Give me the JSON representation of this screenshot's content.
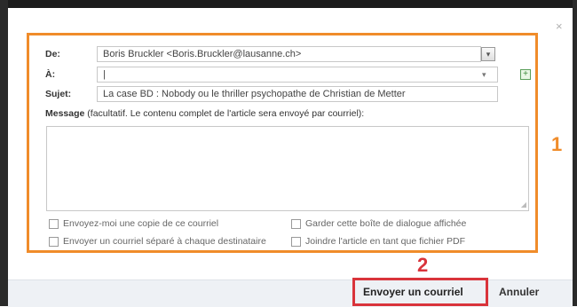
{
  "dialog": {
    "close_symbol": "×",
    "from": {
      "label": "De:",
      "value": "Boris Bruckler <Boris.Bruckler@lausanne.ch>"
    },
    "to": {
      "label": "À:",
      "value": "|"
    },
    "subject": {
      "label": "Sujet:",
      "value": "La case BD : Nobody ou le thriller psychopathe de Christian de Metter"
    },
    "message": {
      "label_bold": "Message",
      "label_note": " (facultatif. Le contenu complet de l'article sera envoyé par courriel):",
      "value": ""
    },
    "options": [
      {
        "label": "Envoyez-moi une copie de ce courriel",
        "checked": false
      },
      {
        "label": "Garder cette boîte de dialogue affichée",
        "checked": false
      },
      {
        "label": "Envoyer un courriel séparé à chaque destinataire",
        "checked": false
      },
      {
        "label": "Joindre l'article en tant que fichier PDF",
        "checked": false
      }
    ]
  },
  "annotations": {
    "box1_number": "1",
    "box2_number": "2"
  },
  "footer": {
    "send_label": "Envoyer un courriel",
    "cancel_label": "Annuler"
  },
  "colors": {
    "annotation_orange": "#f08c2a",
    "annotation_red": "#d9343b",
    "footer_bg": "#eef1f5"
  },
  "icons": {
    "close": "close-icon",
    "dropdown": "chevron-down-icon",
    "address_book": "address-book-icon",
    "resize": "resize-grip-icon"
  }
}
